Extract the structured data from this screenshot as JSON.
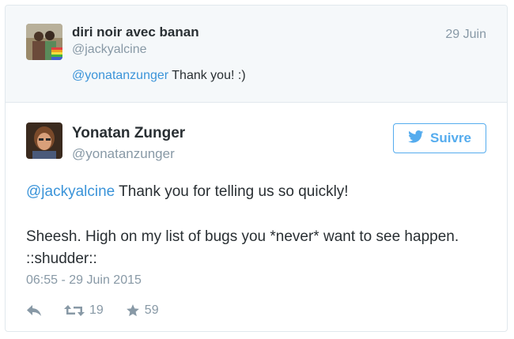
{
  "reply": {
    "name": "diri noir avec banan",
    "handle": "@jackyalcine",
    "date": "29 Juin",
    "mention": "@yonatanzunger",
    "text": " Thank you! :)"
  },
  "tweet": {
    "name": "Yonatan Zunger",
    "handle": "@yonatanzunger",
    "follow_label": "Suivre",
    "mention": "@jackyalcine",
    "line1_text": " Thank you for telling us so quickly!",
    "line2_text": "Sheesh. High on my list of bugs you *never* want to see happen. ::shudder::",
    "timestamp": "06:55 - 29 Juin 2015",
    "retweets": "19",
    "favorites": "59"
  },
  "colors": {
    "accent": "#55acee",
    "link": "#3b94d9",
    "muted": "#8899a6",
    "text": "#292f33",
    "reply_bg": "#f5f8fa"
  },
  "icons": [
    "reply-icon",
    "retweet-icon",
    "favorite-star-icon",
    "twitter-bird-icon"
  ]
}
